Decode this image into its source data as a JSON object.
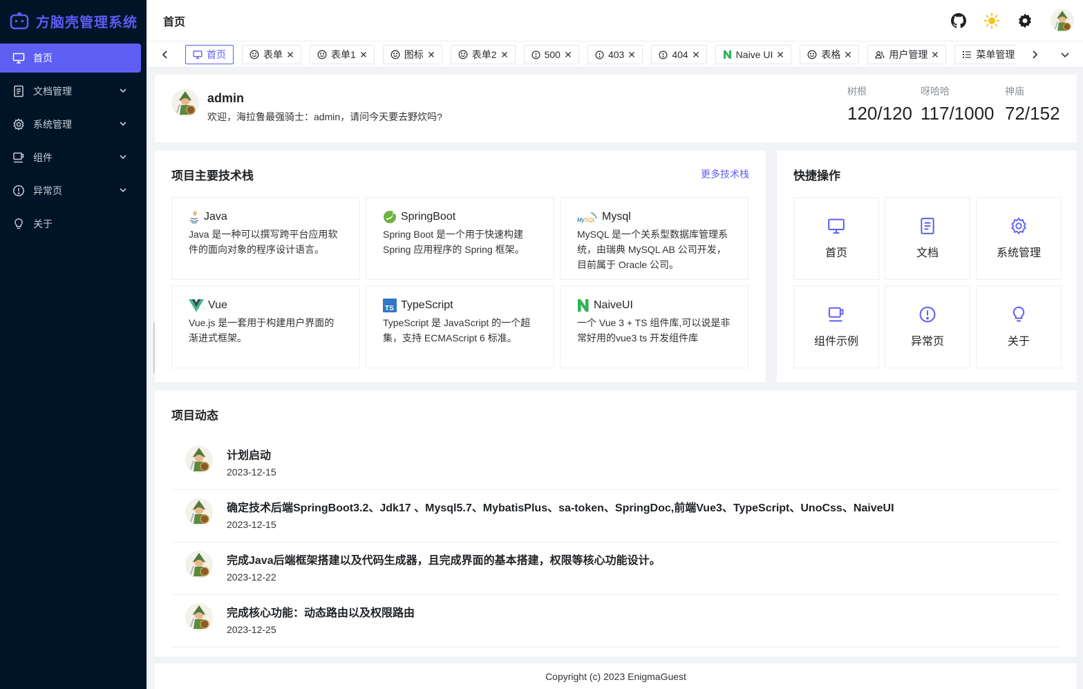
{
  "app": {
    "title": "方脑壳管理系统"
  },
  "sidebar": {
    "items": [
      {
        "label": "首页",
        "icon": "monitor-icon",
        "active": true
      },
      {
        "label": "文档管理",
        "icon": "document-icon",
        "expandable": true
      },
      {
        "label": "系统管理",
        "icon": "gear-icon",
        "expandable": true
      },
      {
        "label": "组件",
        "icon": "cup-icon",
        "expandable": true
      },
      {
        "label": "异常页",
        "icon": "alert-circle-icon",
        "expandable": true
      },
      {
        "label": "关于",
        "icon": "bulb-icon"
      }
    ]
  },
  "header": {
    "title": "首页",
    "actions": [
      "github-icon",
      "sun-icon",
      "gear-icon",
      "avatar"
    ]
  },
  "tabs": [
    {
      "label": "首页",
      "icon": "monitor-icon",
      "active": true
    },
    {
      "label": "表单",
      "icon": "smile-icon",
      "closable": true
    },
    {
      "label": "表单1",
      "icon": "smile-icon",
      "closable": true
    },
    {
      "label": "图标",
      "icon": "smile-icon",
      "closable": true
    },
    {
      "label": "表单2",
      "icon": "smile-icon",
      "closable": true
    },
    {
      "label": "500",
      "icon": "alert-circle-icon",
      "closable": true
    },
    {
      "label": "403",
      "icon": "alert-circle-icon",
      "closable": true
    },
    {
      "label": "404",
      "icon": "alert-circle-icon",
      "closable": true
    },
    {
      "label": "Naive UI",
      "icon": "naive-logo-icon",
      "closable": true
    },
    {
      "label": "表格",
      "icon": "smile-icon",
      "closable": true
    },
    {
      "label": "用户管理",
      "icon": "users-icon",
      "closable": true
    },
    {
      "label": "菜单管理",
      "icon": "list-icon",
      "closable": true
    }
  ],
  "welcome": {
    "name": "admin",
    "message": "欢迎，海拉鲁最强骑士：admin，请问今天要去野炊吗?",
    "stats": [
      {
        "label": "树根",
        "value": "120/120"
      },
      {
        "label": "呀哈哈",
        "value": "117/1000"
      },
      {
        "label": "神庙",
        "value": "72/152"
      }
    ]
  },
  "tech": {
    "title": "项目主要技术栈",
    "more_link": "更多技术栈",
    "items": [
      {
        "name": "Java",
        "icon": "java-icon",
        "desc": "Java 是一种可以撰写跨平台应用软件的面向对象的程序设计语言。"
      },
      {
        "name": "SpringBoot",
        "icon": "spring-icon",
        "desc": "Spring Boot 是一个用于快速构建 Spring 应用程序的 Spring 框架。"
      },
      {
        "name": "Mysql",
        "icon": "mysql-icon",
        "desc": "MySQL 是一个关系型数据库管理系统，由瑞典 MySQL AB 公司开发，目前属于 Oracle 公司。"
      },
      {
        "name": "Vue",
        "icon": "vue-icon",
        "desc": "Vue.js 是一套用于构建用户界面的渐进式框架。"
      },
      {
        "name": "TypeScript",
        "icon": "typescript-icon",
        "desc": "TypeScript 是 JavaScript 的一个超集，支持 ECMAScript 6 标准。"
      },
      {
        "name": "NaiveUI",
        "icon": "naive-logo-icon",
        "desc": "一个 Vue 3 + TS 组件库,可以说是非常好用的vue3 ts 开发组件库"
      }
    ]
  },
  "quick": {
    "title": "快捷操作",
    "items": [
      {
        "label": "首页",
        "icon": "monitor-icon"
      },
      {
        "label": "文档",
        "icon": "document-icon"
      },
      {
        "label": "系统管理",
        "icon": "gear-icon"
      },
      {
        "label": "组件示例",
        "icon": "cup-icon"
      },
      {
        "label": "异常页",
        "icon": "alert-circle-icon"
      },
      {
        "label": "关于",
        "icon": "bulb-icon"
      }
    ]
  },
  "activity": {
    "title": "项目动态",
    "items": [
      {
        "title": "计划启动",
        "date": "2023-12-15"
      },
      {
        "title": "确定技术后端SpringBoot3.2、Jdk17 、Mysql5.7、MybatisPlus、sa-token、SpringDoc,前端Vue3、TypeScript、UnoCss、NaiveUI",
        "date": "2023-12-15"
      },
      {
        "title": "完成Java后端框架搭建以及代码生成器，且完成界面的基本搭建，权限等核心功能设计。",
        "date": "2023-12-22"
      },
      {
        "title": "完成核心功能：动态路由以及权限路由",
        "date": "2023-12-25"
      }
    ]
  },
  "footer": {
    "text": "Copyright (c) 2023 EnigmaGuest"
  },
  "colors": {
    "primary": "#5d5ef2",
    "sidebar_bg": "#001428",
    "page_bg": "#f1f3f6"
  }
}
